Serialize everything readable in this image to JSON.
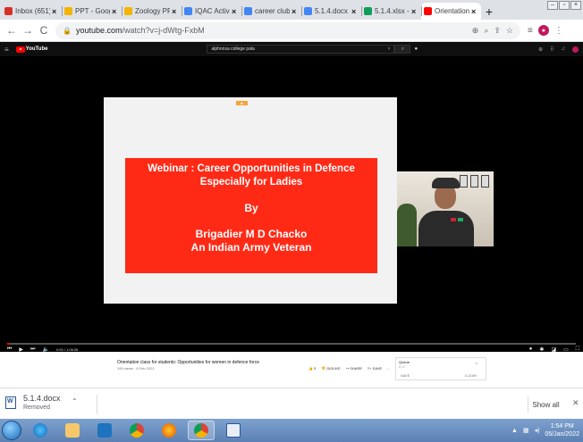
{
  "tabs": [
    {
      "title": "Inbox (651) - ri",
      "favicon_color": "#d93025"
    },
    {
      "title": "PPT - Google D",
      "favicon_color": "#f4b400"
    },
    {
      "title": "Zoology PPT 20",
      "favicon_color": "#f4b400"
    },
    {
      "title": "IQAC Activity -",
      "favicon_color": "#4285f4"
    },
    {
      "title": "career club rep",
      "favicon_color": "#4285f4"
    },
    {
      "title": "5.1.4.docx - Go",
      "favicon_color": "#4285f4"
    },
    {
      "title": "5.1.4.xlsx - Goo",
      "favicon_color": "#0f9d58"
    },
    {
      "title": "Orientation cla",
      "favicon_color": "#ff0000",
      "active": true
    }
  ],
  "address": {
    "host": "youtube.com",
    "path": "/watch?v=j-dWtg-FxbM"
  },
  "youtube": {
    "logo": "YouTube",
    "search_value": "alphonsa college pala",
    "slide": {
      "line1": "Webinar : Career Opportunities in Defence",
      "line2": "Especially for Ladies",
      "line3": "By",
      "line4": "Brigadier M D Chacko",
      "line5": "An Indian Army Veteran"
    },
    "time": "0:00 / 1:06:06",
    "progress_fraction": 0.005,
    "video_title": "Orientation class for students: Opportunities for women in defence force",
    "video_meta": "195 views · 8 Feb 2022",
    "actions": {
      "like": "5",
      "dislike": "DISLIKE",
      "share": "SHARE",
      "save": "SAVE",
      "more": "..."
    },
    "queue": {
      "title": "Queue",
      "count": "1 / 1",
      "save": "SAVE",
      "clear": "CLEAR"
    }
  },
  "download": {
    "filename": "5.1.4.docx",
    "status": "Removed",
    "show_all": "Show all"
  },
  "taskbar": {
    "time": "1:54 PM",
    "date": "05/Jan/2022"
  }
}
